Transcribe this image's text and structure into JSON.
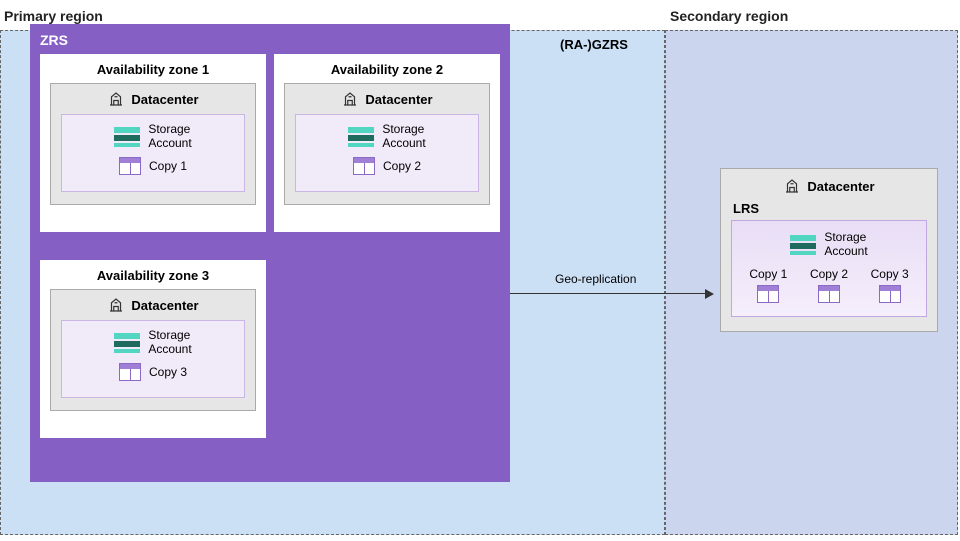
{
  "labels": {
    "primary_region": "Primary region",
    "secondary_region": "Secondary region",
    "zrs": "ZRS",
    "gzrs": "(RA-)GZRS",
    "geo_replication": "Geo-replication",
    "datacenter": "Datacenter",
    "storage_account": "Storage\nAccount",
    "lrs": "LRS"
  },
  "zones": [
    {
      "title": "Availability zone 1",
      "copy": "Copy 1"
    },
    {
      "title": "Availability zone 2",
      "copy": "Copy 2"
    },
    {
      "title": "Availability zone 3",
      "copy": "Copy 3"
    }
  ],
  "secondary_copies": [
    "Copy 1",
    "Copy 2",
    "Copy 3"
  ]
}
